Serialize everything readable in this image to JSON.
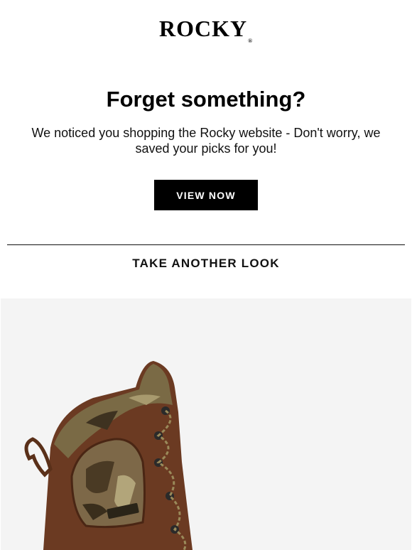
{
  "brand": {
    "logo_text": "ROCKY",
    "logo_mark": "®"
  },
  "hero": {
    "headline": "Forget something?",
    "message": "We noticed you shopping the Rocky website - Don't worry, we saved your picks for you!",
    "cta_label": "VIEW NOW"
  },
  "section": {
    "title": "TAKE ANOTHER LOOK"
  },
  "product": {
    "image": "brown-leather-camo-hunting-boot",
    "background_color": "#f4f4f4"
  },
  "colors": {
    "text": "#111111",
    "button_bg": "#000000",
    "button_text": "#ffffff",
    "boot_leather": "#6b3a22",
    "camo": "#7a6a45"
  }
}
